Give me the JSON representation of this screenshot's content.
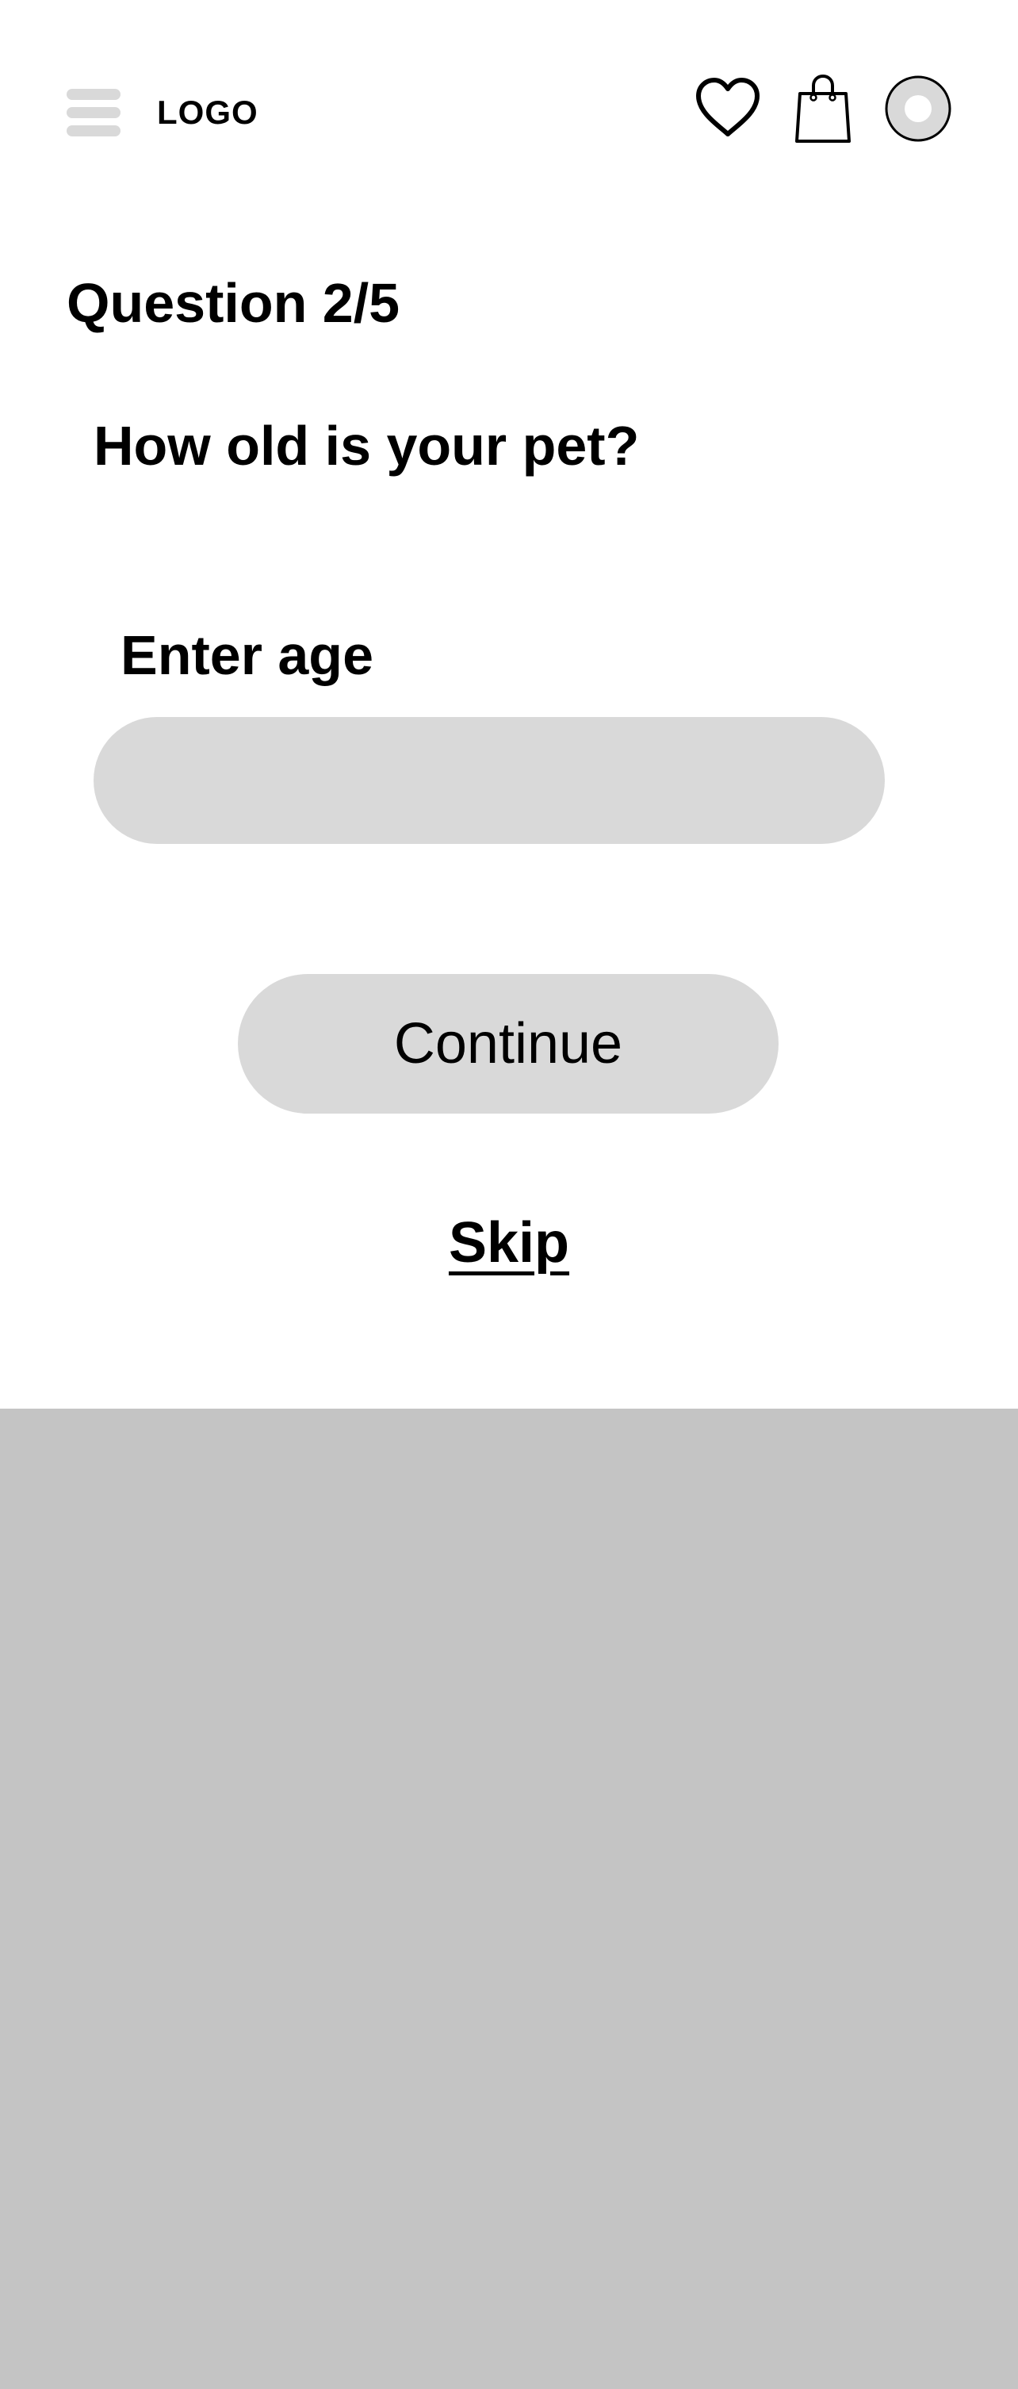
{
  "header": {
    "logo": "LOGO",
    "icons": {
      "menu": "hamburger-menu-icon",
      "favorites": "heart-icon",
      "cart": "shopping-bag-icon",
      "profile": "avatar-icon"
    }
  },
  "quiz": {
    "progress": "Question 2/5",
    "question": "How old is your pet?",
    "field_label": "Enter age",
    "age_value": "",
    "continue_label": "Continue",
    "skip_label": "Skip"
  },
  "colors": {
    "background": "#ffffff",
    "control_fill": "#d9d9d9",
    "lower_panel": "#c4c4c4",
    "text": "#000000"
  }
}
